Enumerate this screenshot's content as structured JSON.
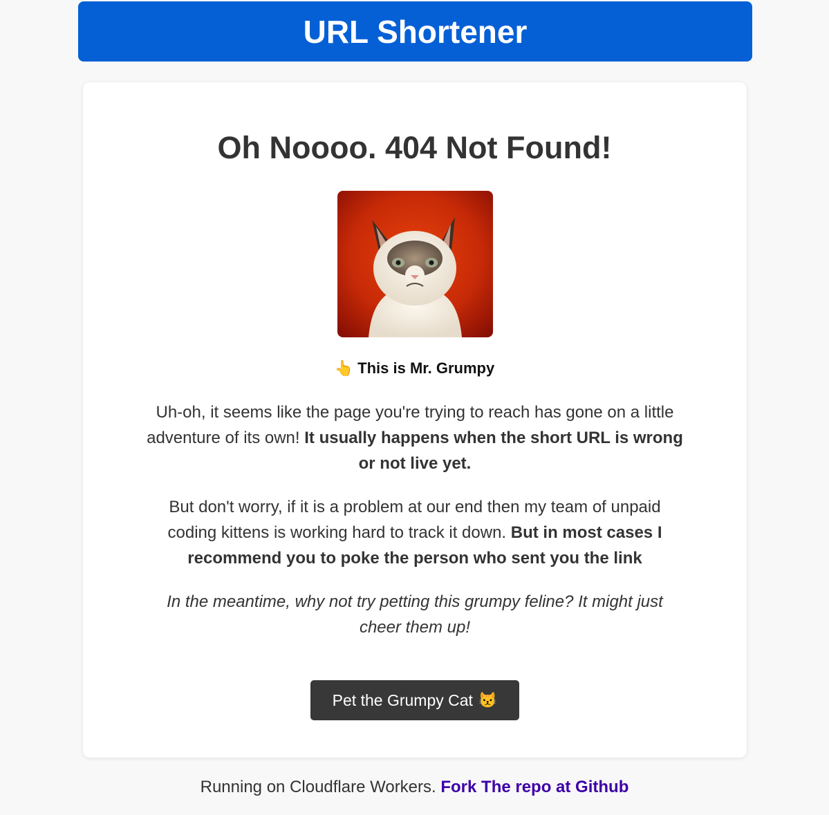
{
  "header": {
    "title": "URL Shortener"
  },
  "main": {
    "heading": "Oh Noooo. 404 Not Found!",
    "image_alt": "Grumpy cat",
    "caption_icon": "👆",
    "caption": "This is Mr. Grumpy",
    "paragraph1": {
      "text": "Uh-oh, it seems like the page you're trying to reach has gone on a little adventure of its own! ",
      "bold": "It usually happens when the short URL is wrong or not live yet."
    },
    "paragraph2": {
      "text": "But don't worry, if it is a problem at our end then my team of unpaid coding kittens is working hard to track it down. ",
      "bold": "But in most cases I recommend you to poke the person who sent you the link"
    },
    "paragraph3": "In the meantime, why not try petting this grumpy feline? It might just cheer them up!",
    "button_label": "Pet the Grumpy Cat",
    "button_emoji": "😾"
  },
  "footer": {
    "text": "Running on Cloudflare Workers. ",
    "link_label": "Fork The repo at Github"
  },
  "colors": {
    "header_bg": "#0560d6",
    "button_bg": "#383838",
    "link": "#3d00a8",
    "page_bg": "#f8f8f8"
  }
}
